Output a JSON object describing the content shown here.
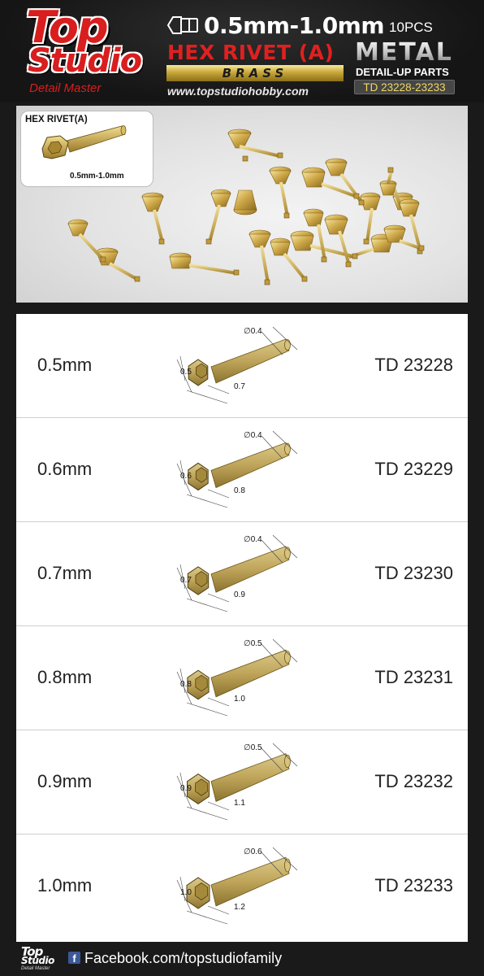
{
  "header": {
    "logo_top": "Top",
    "logo_studio": "Studio",
    "logo_tagline": "Detail Master",
    "size_range": "0.5mm-1.0mm",
    "pcs": "10PCS",
    "product_name": "HEX RIVET (A)",
    "material": "BRASS",
    "website": "www.topstudiohobby.com",
    "metal_label": "METAL",
    "detail_up_label": "DETAIL-UP PARTS",
    "code_range": "TD 23228-23233"
  },
  "photo": {
    "inset_title": "HEX RIVET(A)",
    "inset_size": "0.5mm-1.0mm"
  },
  "specs": [
    {
      "size": "0.5mm",
      "code": "TD 23228",
      "hex": "0.5",
      "head": "0.7",
      "dia": "∅0.4"
    },
    {
      "size": "0.6mm",
      "code": "TD 23229",
      "hex": "0.6",
      "head": "0.8",
      "dia": "∅0.4"
    },
    {
      "size": "0.7mm",
      "code": "TD 23230",
      "hex": "0.7",
      "head": "0.9",
      "dia": "∅0.4"
    },
    {
      "size": "0.8mm",
      "code": "TD 23231",
      "hex": "0.8",
      "head": "1.0",
      "dia": "∅0.5"
    },
    {
      "size": "0.9mm",
      "code": "TD 23232",
      "hex": "0.9",
      "head": "1.1",
      "dia": "∅0.5"
    },
    {
      "size": "1.0mm",
      "code": "TD 23233",
      "hex": "1.0",
      "head": "1.2",
      "dia": "∅0.6"
    }
  ],
  "footer": {
    "logo_top": "Top",
    "logo_studio": "Studio",
    "logo_tagline": "Detail Master",
    "facebook_icon": "facebook-icon",
    "facebook_text": "Facebook.com/topstudiofamily"
  },
  "colors": {
    "brand_red": "#d81e1e",
    "brass": "#c8a73a",
    "code_gold": "#f1d760"
  }
}
